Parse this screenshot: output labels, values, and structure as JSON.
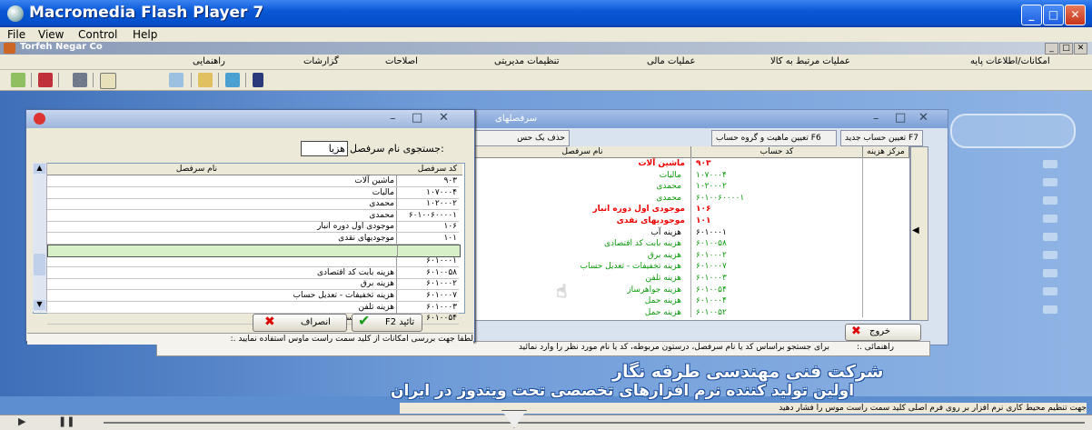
{
  "window": {
    "title": "Macromedia Flash Player 7",
    "minimize_label": "_",
    "maximize_label": "□",
    "close_label": "✕"
  },
  "menubar": {
    "file": "File",
    "view": "View",
    "control": "Control",
    "help": "Help"
  },
  "app": {
    "title": "Torfeh Negar Co",
    "menu": [
      "امکانات/اطلاعات پایه",
      "عملیات مرتبط به کالا",
      "عملیات مالی",
      "تنظیمات مدیریتی",
      "اصلاحات",
      "گزارشات",
      "راهنمایی"
    ]
  },
  "bigwin": {
    "title": "سرفصلهای",
    "btn_new": "تعیین حساب جدید F7",
    "btn_type": "تعیین ماهیت و گروه حساب F6",
    "btn_del": "حذف یک حس",
    "col_center": "مرکز هزینه",
    "col_code": "کد حساب",
    "col_name": "نام سرفصل",
    "rows": [
      {
        "code": "۹۰۳",
        "name": "ماشین آلات",
        "style": "red"
      },
      {
        "code": "۱۰۷۰۰۰۴",
        "name": "مالیات",
        "style": "green"
      },
      {
        "code": "۱۰۲۰۰۰۲",
        "name": "محمدی",
        "style": "green"
      },
      {
        "code": "۶۰۱۰۰۶۰۰۰۰۱",
        "name": "محمدی",
        "style": "green"
      },
      {
        "code": "۱۰۶",
        "name": "موجودی اول دوره انبار",
        "style": "red"
      },
      {
        "code": "۱۰۱",
        "name": "موجودیهای نقدی",
        "style": "red"
      },
      {
        "code": "۶۰۱۰۰۰۱",
        "name": "هزینه آب",
        "style": "black"
      },
      {
        "code": "۶۰۱۰۰۵۸",
        "name": "هزینه بابت کد اقتصادی",
        "style": "green"
      },
      {
        "code": "۶۰۱۰۰۰۲",
        "name": "هزینه برق",
        "style": "green"
      },
      {
        "code": "۶۰۱۰۰۰۷",
        "name": "هزینه تخفیفات - تعدیل حساب",
        "style": "green"
      },
      {
        "code": "۶۰۱۰۰۰۳",
        "name": "هزینه تلفن",
        "style": "green"
      },
      {
        "code": "۶۰۱۰۰۵۴",
        "name": "هزینه جواهرساز",
        "style": "green"
      },
      {
        "code": "۶۰۱۰۰۰۴",
        "name": "هزینه حمل",
        "style": "green"
      },
      {
        "code": "۶۰۱۰۰۵۲",
        "name": "هزینه حمل",
        "style": "green"
      }
    ],
    "exit_label": "خروج",
    "help_label": ":. راهنمائی",
    "help_text": "برای جستجو براساس کد یا نام سرفصل، درستون مربوطه، کد یا نام مورد نظر را وارد نمائید"
  },
  "dialog": {
    "search_label": "جستجوی نام سرفصل:",
    "search_value": "هزیا",
    "col_code": "کد سرفصل",
    "col_name": "نام سرفصل",
    "rows": [
      {
        "code": "۹۰۳",
        "name": "ماشین آلات"
      },
      {
        "code": "۱۰۷۰۰۰۴",
        "name": "مالیات"
      },
      {
        "code": "۱۰۲۰۰۰۲",
        "name": "محمدی"
      },
      {
        "code": "۶۰۱۰۰۶۰۰۰۰۱",
        "name": "محمدی"
      },
      {
        "code": "۱۰۶",
        "name": "موجودی اول دوره انبار"
      },
      {
        "code": "۱۰۱",
        "name": "موجودیهای نقدی"
      },
      {
        "code": "",
        "name": ""
      },
      {
        "code": "۶۰۱۰۰۰۱",
        "name": ""
      },
      {
        "code": "۶۰۱۰۰۵۸",
        "name": "هزینه بابت کد اقتصادی"
      },
      {
        "code": "۶۰۱۰۰۰۲",
        "name": "هزینه برق"
      },
      {
        "code": "۶۰۱۰۰۰۷",
        "name": "هزینه تخفیفات - تعدیل حساب"
      },
      {
        "code": "۶۰۱۰۰۰۳",
        "name": "هزینه تلفن"
      },
      {
        "code": "۶۰۱۰۰۵۴",
        "name": "هزینه جواهرساز"
      }
    ],
    "ok_label": "F2 تائید",
    "cancel_label": "انصراف",
    "hint": ":. لطفا جهت بررسی امکانات از کلید سمت راست ماوس استفاده نمایید"
  },
  "banner": {
    "line1": "شرکت فنی مهندسی طرفه نگار",
    "line2": "اولین تولید کننده نرم افزارهای تخصصی تحت ویندوز در ایران"
  },
  "statusbar": {
    "text": "جهت تنظیم محیط کاری نرم افزار بر روی فرم اصلی کلید سمت راست موس را فشار دهید"
  },
  "colors": {
    "titlebar": "#0a58d6",
    "workspace": "#5d8fd0",
    "green_text": "#0a9a0a",
    "red_text": "#e00000"
  }
}
